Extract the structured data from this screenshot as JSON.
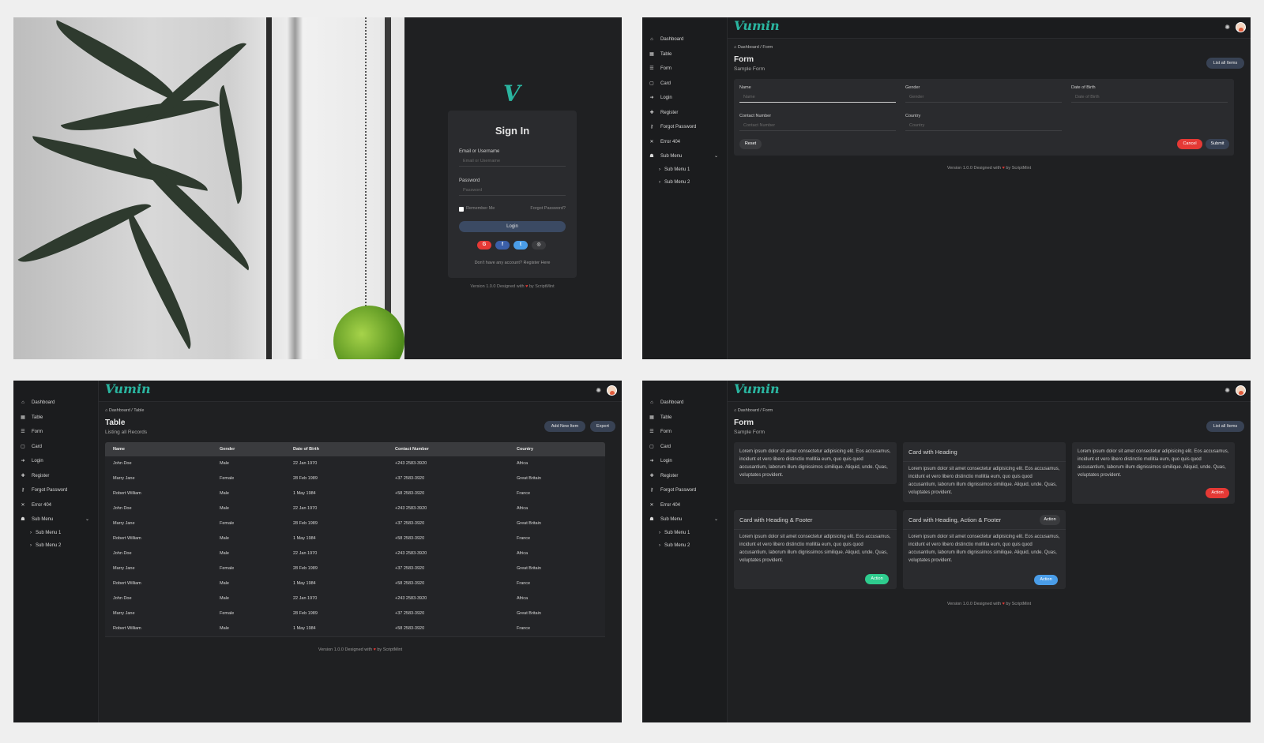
{
  "signin": {
    "logo": "V",
    "title": "Sign In",
    "email_label": "Email or Username",
    "email_placeholder": "Email or Username",
    "password_label": "Password",
    "password_placeholder": "Password",
    "remember": "Remember Me",
    "forgot": "Forgot Password?",
    "login": "Login",
    "social": [
      {
        "icon": "google-icon",
        "glyph": "G",
        "color": "#e53935"
      },
      {
        "icon": "facebook-icon",
        "glyph": "f",
        "color": "#3b5fa8"
      },
      {
        "icon": "twitter-icon",
        "glyph": "t",
        "color": "#4a9de8"
      },
      {
        "icon": "github-icon",
        "glyph": "◎",
        "color": "#3a3b3e"
      }
    ],
    "register": "Don't have any account? Register Here"
  },
  "brand": "Vumin",
  "version_prefix": "Version 1.0.0 Designed with",
  "version_suffix": "by ScriptMint",
  "sidebar": [
    {
      "icon": "home-icon",
      "glyph": "⌂",
      "label": "Dashboard"
    },
    {
      "icon": "table-icon",
      "glyph": "▦",
      "label": "Table"
    },
    {
      "icon": "form-icon",
      "glyph": "☰",
      "label": "Form"
    },
    {
      "icon": "card-icon",
      "glyph": "▢",
      "label": "Card"
    },
    {
      "icon": "login-icon",
      "glyph": "➜",
      "label": "Login"
    },
    {
      "icon": "register-icon",
      "glyph": "✚",
      "label": "Register"
    },
    {
      "icon": "key-icon",
      "glyph": "⚷",
      "label": "Forgot Password"
    },
    {
      "icon": "close-icon",
      "glyph": "✕",
      "label": "Error 404"
    },
    {
      "icon": "users-icon",
      "glyph": "☗",
      "label": "Sub Menu"
    },
    {
      "icon": "chevron-right-icon",
      "glyph": "›",
      "label": "Sub Menu 1"
    },
    {
      "icon": "chevron-right-icon",
      "glyph": "›",
      "label": "Sub Menu 2"
    }
  ],
  "form_page": {
    "breadcrumb_home": "Dashboard",
    "breadcrumb_current": "Form",
    "title": "Form",
    "subtitle": "Sample Form",
    "list_button": "List all Items",
    "fields": [
      {
        "label": "Name",
        "placeholder": "Name"
      },
      {
        "label": "Gender",
        "placeholder": "Gender"
      },
      {
        "label": "Date of Birth",
        "placeholder": "Date of Birth"
      },
      {
        "label": "Contact Number",
        "placeholder": "Contact Number"
      },
      {
        "label": "Country",
        "placeholder": "Country"
      }
    ],
    "reset": "Reset",
    "cancel": "Cancel",
    "submit": "Submit"
  },
  "table_page": {
    "breadcrumb_home": "Dashboard",
    "breadcrumb_current": "Table",
    "title": "Table",
    "subtitle": "Listing all Records",
    "add_button": "Add New Item",
    "export_button": "Export",
    "columns": [
      "Name",
      "Gender",
      "Date of Birth",
      "Contact Number",
      "Country"
    ],
    "rows": [
      [
        "John Doe",
        "Male",
        "22 Jan 1970",
        "+243 2583-3920",
        "Africa"
      ],
      [
        "Marry Jane",
        "Female",
        "28 Feb 1989",
        "+37 2583-3920",
        "Great Britain"
      ],
      [
        "Robert William",
        "Male",
        "1 May 1984",
        "+58 2583-3920",
        "France"
      ],
      [
        "John Doe",
        "Male",
        "22 Jan 1970",
        "+243 2583-3920",
        "Africa"
      ],
      [
        "Marry Jane",
        "Female",
        "28 Feb 1989",
        "+37 2583-3920",
        "Great Britain"
      ],
      [
        "Robert William",
        "Male",
        "1 May 1984",
        "+58 2583-3920",
        "France"
      ],
      [
        "John Doe",
        "Male",
        "22 Jan 1970",
        "+243 2583-3920",
        "Africa"
      ],
      [
        "Marry Jane",
        "Female",
        "28 Feb 1989",
        "+37 2583-3920",
        "Great Britain"
      ],
      [
        "Robert William",
        "Male",
        "1 May 1984",
        "+58 2583-3920",
        "France"
      ],
      [
        "John Doe",
        "Male",
        "22 Jan 1970",
        "+243 2583-3920",
        "Africa"
      ],
      [
        "Marry Jane",
        "Female",
        "28 Feb 1989",
        "+37 2583-3920",
        "Great Britain"
      ],
      [
        "Robert William",
        "Male",
        "1 May 1984",
        "+58 2583-3920",
        "France"
      ]
    ]
  },
  "card_page": {
    "breadcrumb_home": "Dashboard",
    "breadcrumb_current": "Form",
    "title": "Form",
    "subtitle": "Sample Form",
    "list_button": "List all Items",
    "lorem": "Lorem ipsum dolor sit amet consectetur adipisicing elit. Eos accusamus, incidunt et vero libero distinctio mollitia eum, quo quis quod accusantium, laborum illum dignissimos similique. Aliquid, unde. Quas, voluptates provident.",
    "cards": [
      {
        "heading": "",
        "action": ""
      },
      {
        "heading": "Card with Heading",
        "action": ""
      },
      {
        "heading": "",
        "action": "Action"
      },
      {
        "heading": "Card with Heading & Footer",
        "action": "Action"
      },
      {
        "heading": "Card with Heading, Action & Footer",
        "badge": "Action",
        "action": "Action"
      }
    ]
  },
  "colors": {
    "accent": "#2ab5a0",
    "danger": "#e53935",
    "success": "#2ecc8e",
    "info": "#4a9de8",
    "pill": "#384254"
  }
}
